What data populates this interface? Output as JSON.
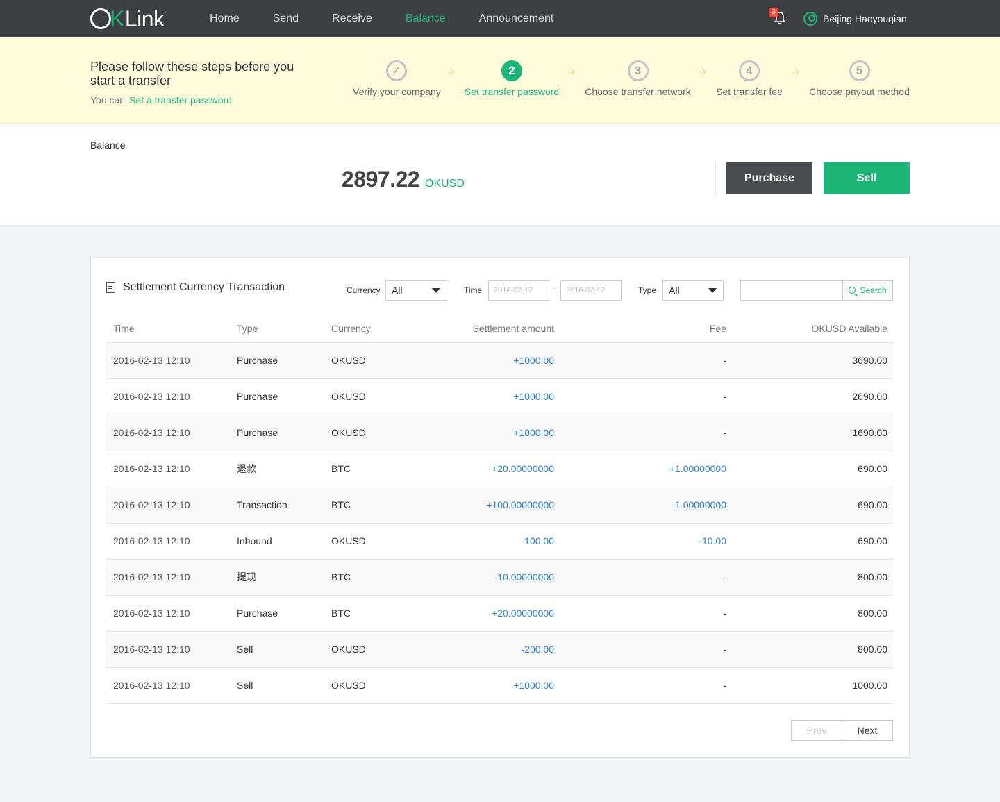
{
  "nav": {
    "logo_o": "O",
    "logo_k": "K",
    "logo_rest": "Link",
    "items": [
      "Home",
      "Send",
      "Receive",
      "Balance",
      "Announcement"
    ],
    "active_item": "Balance",
    "notification_count": "3",
    "user_name": "Beijing  Haoyouqian"
  },
  "steps": {
    "title": "Please follow these steps before you start a transfer",
    "sub_prefix": "You can",
    "sub_link": "Set a transfer password",
    "items": [
      {
        "num": "✓",
        "label": "Verify your company"
      },
      {
        "num": "2",
        "label": "Set transfer password"
      },
      {
        "num": "3",
        "label": "Choose transfer network"
      },
      {
        "num": "4",
        "label": "Set transfer fee"
      },
      {
        "num": "5",
        "label": "Choose payout method"
      }
    ],
    "arrow": "➔"
  },
  "balance": {
    "label": "Balance",
    "amount": "2897.22",
    "unit": "OKUSD",
    "purchase_label": "Purchase",
    "sell_label": "Sell"
  },
  "transactions": {
    "title": "Settlement Currency Transaction",
    "filters": {
      "currency_label": "Currency",
      "currency_value": "All",
      "time_label": "Time",
      "date_from_placeholder": "2016-02-12",
      "date_to_placeholder": "2016-02-12",
      "date_separator": "–",
      "type_label": "Type",
      "type_value": "All",
      "search_label": "Search"
    },
    "columns": {
      "time": "Time",
      "type": "Type",
      "currency": "Currency",
      "amount": "Settlement amount",
      "fee": "Fee",
      "available": "OKUSD Available"
    },
    "rows": [
      {
        "time": "2016-02-13  12:10",
        "type": "Purchase",
        "currency": "OKUSD",
        "amount": "+1000.00",
        "fee": "-",
        "available": "3690.00"
      },
      {
        "time": "2016-02-13  12:10",
        "type": "Purchase",
        "currency": "OKUSD",
        "amount": "+1000.00",
        "fee": "-",
        "available": "2690.00"
      },
      {
        "time": "2016-02-13  12:10",
        "type": "Purchase",
        "currency": "OKUSD",
        "amount": "+1000.00",
        "fee": "-",
        "available": "1690.00"
      },
      {
        "time": "2016-02-13  12:10",
        "type": "退款",
        "currency": "BTC",
        "amount": "+20.00000000",
        "fee": "+1.00000000",
        "available": "690.00"
      },
      {
        "time": "2016-02-13  12:10",
        "type": "Transaction",
        "currency": "BTC",
        "amount": "+100.00000000",
        "fee": "-1.00000000",
        "available": "690.00"
      },
      {
        "time": "2016-02-13  12:10",
        "type": "Inbound",
        "currency": "OKUSD",
        "amount": "-100.00",
        "fee": "-10.00",
        "available": "690.00"
      },
      {
        "time": "2016-02-13  12:10",
        "type": "提现",
        "currency": "BTC",
        "amount": "-10.00000000",
        "fee": "-",
        "available": "800.00"
      },
      {
        "time": "2016-02-13  12:10",
        "type": "Purchase",
        "currency": "BTC",
        "amount": "+20.00000000",
        "fee": "-",
        "available": "800.00"
      },
      {
        "time": "2016-02-13  12:10",
        "type": "Sell",
        "currency": "OKUSD",
        "amount": "-200.00",
        "fee": "-",
        "available": "800.00"
      },
      {
        "time": "2016-02-13  12:10",
        "type": "Sell",
        "currency": "OKUSD",
        "amount": "+1000.00",
        "fee": "-",
        "available": "1000.00"
      }
    ],
    "pager": {
      "prev": "Prev",
      "next": "Next"
    }
  }
}
